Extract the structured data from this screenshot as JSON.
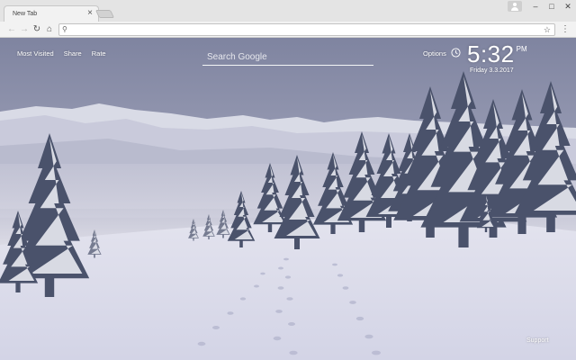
{
  "browser": {
    "tab_title": "New Tab",
    "tab_close": "×",
    "window_controls": {
      "minimize": "–",
      "maximize": "□",
      "close": "✕"
    },
    "nav": {
      "back": "←",
      "forward": "→",
      "reload": "↻",
      "home": "⌂"
    },
    "address_bar": {
      "value": "",
      "search_glyph": "⚲",
      "star": "☆"
    },
    "menu": "⋮"
  },
  "newtab": {
    "links": [
      "Most Visited",
      "Share",
      "Rate"
    ],
    "search_placeholder": "Search Google",
    "options_label": "Options",
    "clock": {
      "time": "5:32",
      "ampm": "PM",
      "date": "Friday  3.3.2017"
    },
    "support_label": "Support",
    "background": {
      "subject": "snowy pine forest and mountains",
      "sky_color": "#8e92aa",
      "snow_color": "#e6e8f2"
    }
  }
}
